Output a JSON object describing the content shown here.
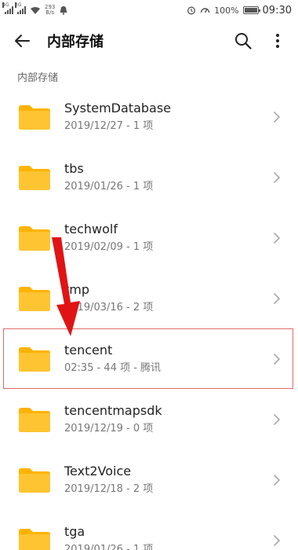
{
  "status_bar": {
    "speed_value": "293",
    "speed_unit": "B/s",
    "battery": "100%",
    "time": "09:30"
  },
  "app_bar": {
    "title": "内部存储",
    "back_icon": "arrow-left-icon",
    "search_icon": "search-icon",
    "more_icon": "more-vertical-icon"
  },
  "breadcrumb": "内部存储",
  "colors": {
    "folder": "#FFC432",
    "folder_tab": "#FFB300",
    "highlight_border": "#E06A6A",
    "annotation_arrow": "#E01414"
  },
  "files": [
    {
      "name": "SystemDatabase",
      "meta": "2019/12/27 - 1 项"
    },
    {
      "name": "tbs",
      "meta": "2019/01/26 - 1 项"
    },
    {
      "name": "techwolf",
      "meta": "2019/02/09 - 1 项"
    },
    {
      "name": "tmp",
      "meta": "2019/03/16 - 2 项"
    },
    {
      "name": "tencent",
      "meta": "02:35 - 44 项 - 腾讯"
    },
    {
      "name": "tencentmapsdk",
      "meta": "2019/12/19 - 0 项"
    },
    {
      "name": "Text2Voice",
      "meta": "2019/12/18 - 2 项"
    },
    {
      "name": "tga",
      "meta": "2019/01/26 - 1 项"
    }
  ]
}
